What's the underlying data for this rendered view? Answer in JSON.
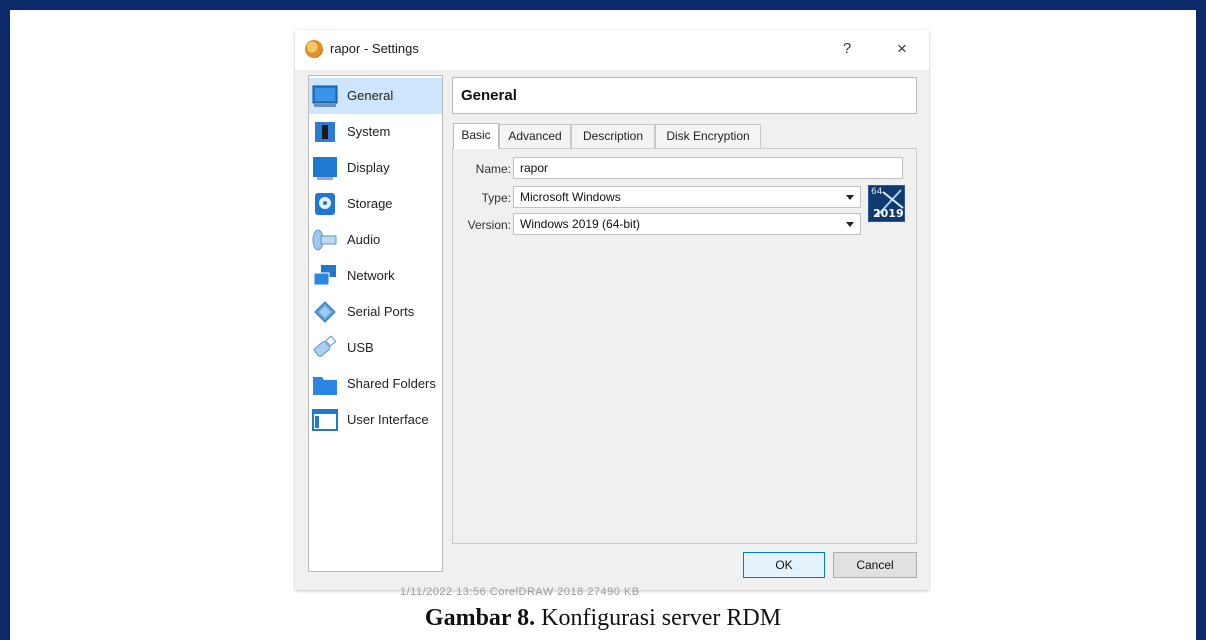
{
  "window": {
    "title": "rapor - Settings",
    "help_symbol": "?",
    "close_symbol": "×"
  },
  "sidebar": {
    "items": [
      {
        "label": "General",
        "icon": "monitor-icon",
        "active": true
      },
      {
        "label": "System",
        "icon": "chip-icon"
      },
      {
        "label": "Display",
        "icon": "display-icon"
      },
      {
        "label": "Storage",
        "icon": "disk-icon"
      },
      {
        "label": "Audio",
        "icon": "speaker-icon"
      },
      {
        "label": "Network",
        "icon": "network-icon"
      },
      {
        "label": "Serial Ports",
        "icon": "serial-port-icon"
      },
      {
        "label": "USB",
        "icon": "usb-icon"
      },
      {
        "label": "Shared Folders",
        "icon": "folder-icon"
      },
      {
        "label": "User Interface",
        "icon": "window-icon"
      }
    ]
  },
  "main": {
    "header": "General",
    "tabs": [
      "Basic",
      "Advanced",
      "Description",
      "Disk Encryption"
    ],
    "active_tab": "Basic",
    "form": {
      "name_label": "Name:",
      "name_value": "rapor",
      "type_label": "Type:",
      "type_value": "Microsoft Windows",
      "version_label": "Version:",
      "version_value": "Windows 2019 (64-bit)",
      "os_badge_bits": "64",
      "os_badge_year": "2019"
    }
  },
  "buttons": {
    "ok": "OK",
    "cancel": "Cancel"
  },
  "background_text": "1/11/2022 13:56          CorelDRAW 2018          27490 KB",
  "caption": {
    "bold": "Gambar 8.",
    "text": " Konfigurasi server RDM"
  },
  "colors": {
    "frame": "#0c2a6a",
    "selection": "#cde6fb",
    "default_button_border": "#0078d7"
  }
}
